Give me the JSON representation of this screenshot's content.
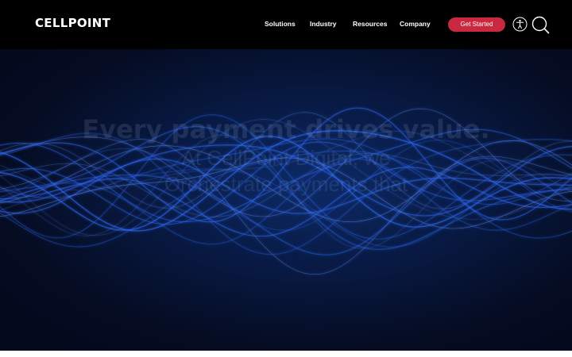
{
  "brand": {
    "logo_text": "CELLPOINT"
  },
  "nav": {
    "items": [
      {
        "label": "Solutions"
      },
      {
        "label": "Industry"
      },
      {
        "label": "Resources"
      },
      {
        "label": "Company"
      }
    ],
    "cta_label": "Get Started",
    "accessibility_icon": "accessibility-icon",
    "search_icon": "search-icon"
  },
  "hero": {
    "headline": "Every payment drives value.",
    "subline_1": "At CellPoint Digital, we",
    "subline_2": "Orchestrate payments that"
  },
  "colors": {
    "header_bg": "#000000",
    "cta_bg": "#c9283e",
    "hero_bg": "#050c22",
    "wave": "#2f6cff"
  }
}
